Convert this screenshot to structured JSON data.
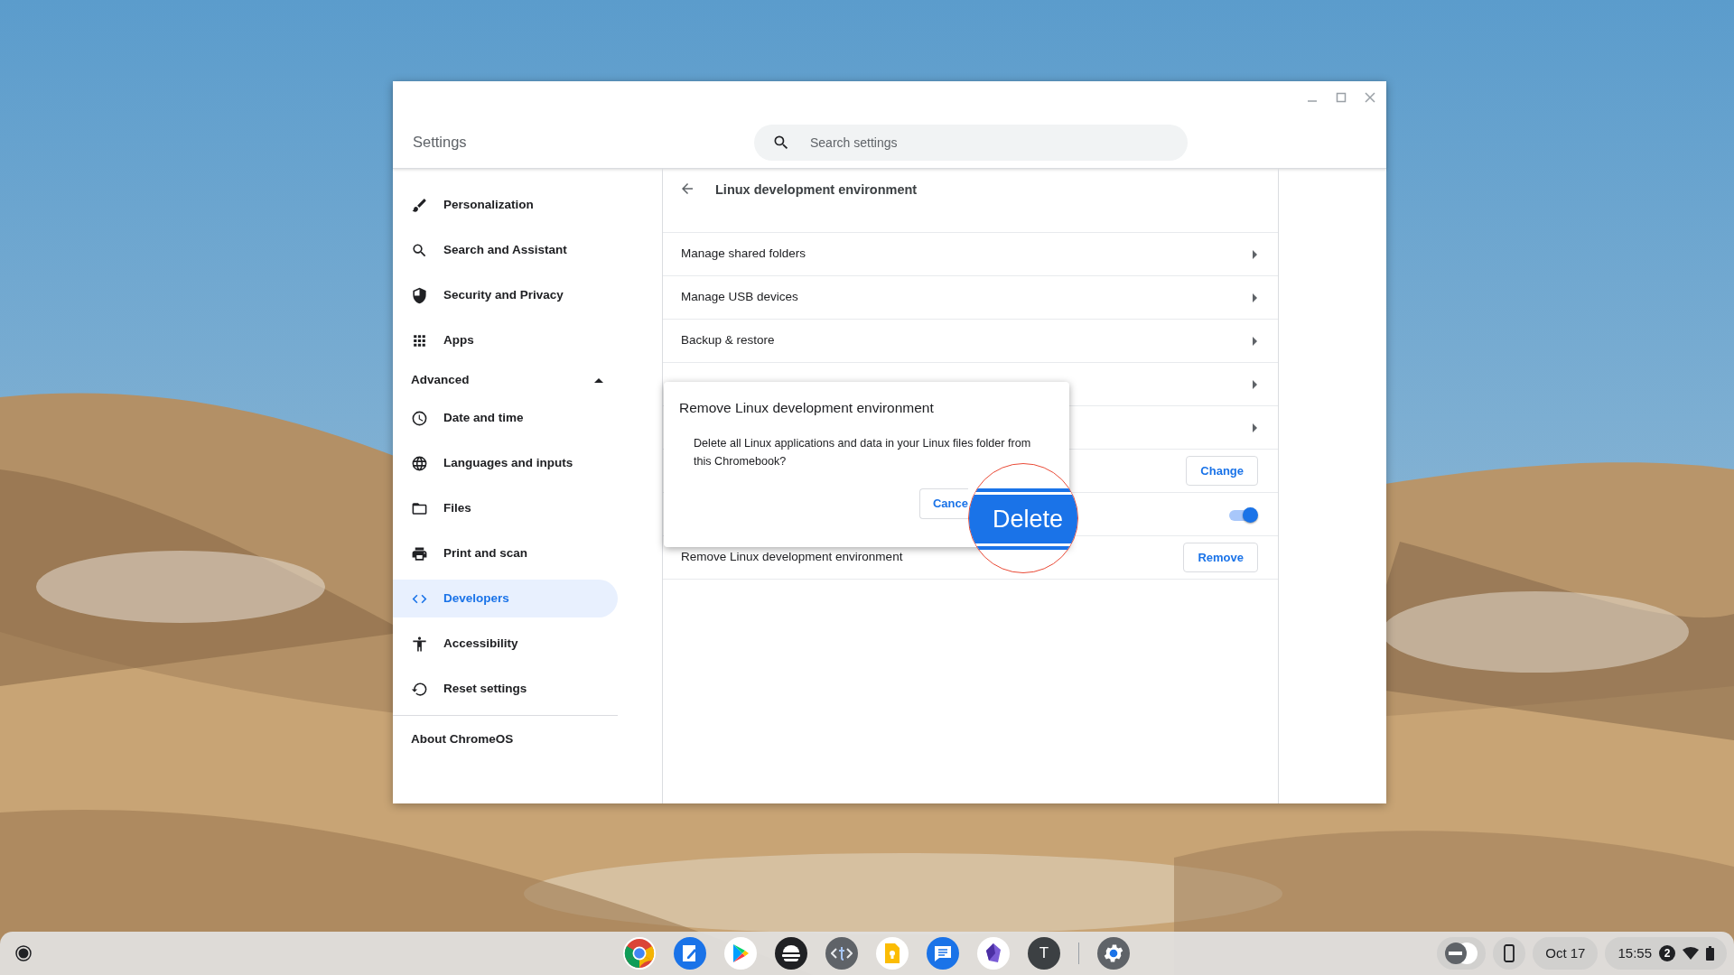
{
  "window": {
    "title": "Settings"
  },
  "search": {
    "placeholder": "Search settings"
  },
  "sidebar": {
    "items": [
      {
        "label": "Personalization",
        "selected": false
      },
      {
        "label": "Search and Assistant",
        "selected": false
      },
      {
        "label": "Security and Privacy",
        "selected": false
      },
      {
        "label": "Apps",
        "selected": false
      }
    ],
    "advanced": {
      "label": "Advanced",
      "expanded": true
    },
    "advanced_items": [
      {
        "label": "Date and time",
        "selected": false
      },
      {
        "label": "Languages and inputs",
        "selected": false
      },
      {
        "label": "Files",
        "selected": false
      },
      {
        "label": "Print and scan",
        "selected": false
      },
      {
        "label": "Developers",
        "selected": true
      },
      {
        "label": "Accessibility",
        "selected": false
      },
      {
        "label": "Reset settings",
        "selected": false
      }
    ],
    "about": "About ChromeOS"
  },
  "page": {
    "title": "Linux development environment",
    "rows": [
      {
        "kind": "link",
        "label": "Manage shared folders"
      },
      {
        "kind": "link",
        "label": "Manage USB devices"
      },
      {
        "kind": "link",
        "label": "Backup & restore"
      },
      {
        "kind": "link"
      },
      {
        "kind": "link"
      },
      {
        "kind": "button",
        "button": "Change"
      },
      {
        "kind": "toggle",
        "on": true
      },
      {
        "kind": "button",
        "label": "Remove Linux development environment",
        "button": "Remove"
      }
    ]
  },
  "dialog": {
    "title": "Remove Linux development environment",
    "message": "Delete all Linux applications and data in your Linux files folder from this Chromebook?",
    "cancel": "Cance"
  },
  "magnifier": {
    "label": "Delete"
  },
  "shelf": {
    "letter_app": "T",
    "date": "Oct 17",
    "time": "15:55",
    "notifications": "2"
  }
}
